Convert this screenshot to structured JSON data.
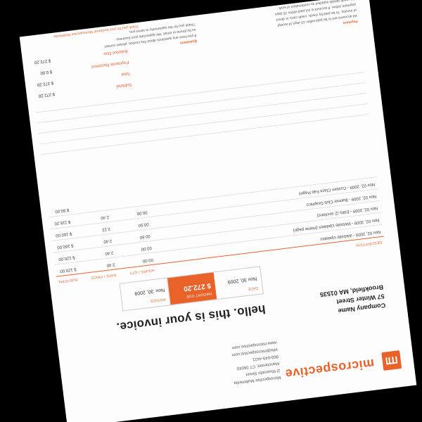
{
  "brand": {
    "name": "microspective"
  },
  "sender": {
    "lines": [
      "Microspective Multimedia",
      "2l Riverside Street",
      "Manchester, CT 06040",
      "860-649-4421",
      "info@microspective.com",
      "www.microspective.com"
    ]
  },
  "client": {
    "name": "Company Name",
    "street": "57 Winter Street",
    "city": "Brookfield, MA 01535"
  },
  "headline": "hello. this is your invoice.",
  "meta": {
    "date_label": "date",
    "date_value": "Nov 30, 2009",
    "due_label": "amount due",
    "due_value": "$ 272.20",
    "num_label": "invoice",
    "num_value": "Nov. 30, 2009"
  },
  "items": {
    "headers": {
      "desc": "description",
      "qty": "hours / qty",
      "rate": "rate / price",
      "amt": "subtotal"
    },
    "rows": [
      {
        "desc": "Nov 02, 2009 - Website Updates",
        "qty": "00.00",
        "rate": "2.40",
        "amt": "$ 120.00"
      },
      {
        "desc": "Nov 02, 2009 - Website Updates (Home page)",
        "qty": "00.00",
        "rate": "2.40",
        "amt": "$ 120.00"
      },
      {
        "desc": "Nov 02, 2009 - Edits (2 sections)",
        "qty": "00.50",
        "rate": "2.40",
        "amt": "$ 160.00"
      },
      {
        "desc": "Nov 02, 2009 - Banner Club Graphics",
        "qty": "00.50",
        "rate": "2.12",
        "amt": "$ 160.00"
      },
      {
        "desc": "Nov 02, 2009 - Custom Class Fab Pages",
        "qty": "00.00",
        "rate": "2.40",
        "amt": "$ 115.20"
      },
      {
        "desc": "",
        "qty": "",
        "rate": "",
        "amt": "$ 80.00"
      }
    ]
  },
  "totals": [
    {
      "label": "Subtotal",
      "value": "$ 272.20"
    },
    {
      "label": "Total",
      "value": "$ 272.20"
    },
    {
      "label": "Payments Received",
      "value": "$ 0.00"
    },
    {
      "label": "Balance Due",
      "value": "$ 272.20"
    }
  ],
  "notes": {
    "left_title": "Payment",
    "left_lines": [
      "All accounts are to be paid within 15 days of receipt",
      "of invoice. To be paid by check, credit card, or direct",
      "payment online. If account is not paid within 15 days",
      "the credit details supplied as confirmation of work"
    ],
    "right_title": "Questions",
    "right_lines": [
      "If you have any questions about this invoice, please contact",
      "us by phone or email. We appreciate your business.",
      "Thank you for the opportunity to serve you."
    ],
    "tagline": "Thank you for your business! Microspective Multimedia"
  }
}
